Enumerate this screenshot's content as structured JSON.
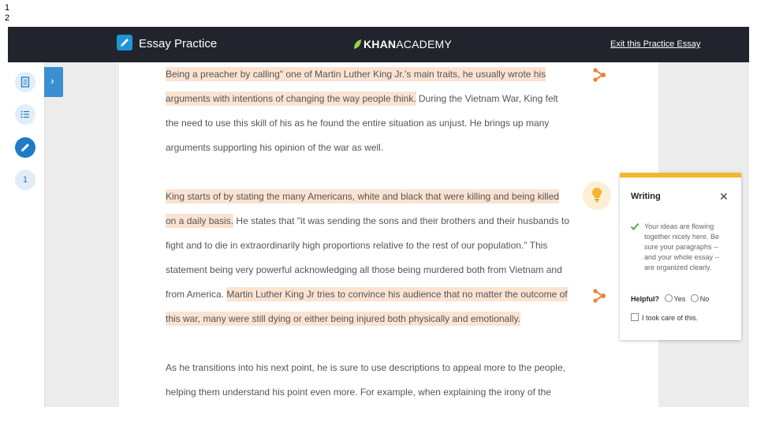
{
  "slide": {
    "numbers": [
      "1",
      "2"
    ]
  },
  "header": {
    "app_title": "Essay Practice",
    "logo_bold": "KHAN",
    "logo_rest": "ACADEMY",
    "exit_label": "Exit this Practice Essay"
  },
  "sidebar": {
    "items": [
      {
        "icon": "document-icon"
      },
      {
        "icon": "list-icon"
      },
      {
        "icon": "pencil-icon",
        "active": true
      },
      {
        "label": "1"
      }
    ],
    "toggle_label": "›"
  },
  "essay": {
    "para1": [
      {
        "parts": [
          {
            "text": "Being a preacher by calling\" one of Martin Luther King Jr.'s main traits, he usually wrote his",
            "hl": true
          }
        ]
      },
      {
        "parts": [
          {
            "text": "arguments with intentions of changing the way people think.",
            "hl": true
          },
          {
            "text": " During the Vietnam War, King felt",
            "hl": false
          }
        ]
      },
      {
        "parts": [
          {
            "text": "the need to use this skill of his as he found the entire situation as unjust. He brings up many",
            "hl": false
          }
        ]
      },
      {
        "parts": [
          {
            "text": "arguments supporting his opinion of the war as well.",
            "hl": false
          }
        ]
      }
    ],
    "para2": [
      {
        "parts": [
          {
            "text": "King starts of by stating the many Americans, white and black that were killing and being killed",
            "hl": true
          }
        ]
      },
      {
        "parts": [
          {
            "text": "on a daily basis.",
            "hl": true
          },
          {
            "text": " He states that \"it was sending the sons and their brothers and their husbands to",
            "hl": false
          }
        ]
      },
      {
        "parts": [
          {
            "text": "fight and to die in extraordinarily high proportions relative to the rest of our population.\" This",
            "hl": false
          }
        ]
      },
      {
        "parts": [
          {
            "text": "statement being very powerful acknowledging all those being murdered both from Vietnam and",
            "hl": false
          }
        ]
      },
      {
        "parts": [
          {
            "text": "from America. ",
            "hl": false
          },
          {
            "text": "Martin Luther King Jr tries to convince his audience that no matter the outcome of",
            "hl": true
          }
        ]
      },
      {
        "parts": [
          {
            "text": "this war, many were still dying or either being injured both physically and emotionally.",
            "hl": true
          }
        ]
      }
    ],
    "para3": [
      {
        "parts": [
          {
            "text": "As he transitions into his next point, he is sure to use descriptions to appeal more to the people,",
            "hl": false
          }
        ]
      },
      {
        "parts": [
          {
            "text": "helping them understand his point even more. For example, when explaining the irony of the",
            "hl": false
          }
        ]
      }
    ]
  },
  "feedback": {
    "category": "Writing",
    "close_icon": "close-icon",
    "message": "Your ideas are flowing together nicely here. Be sure your paragraphs -- and your whole essay -- are organized clearly.",
    "helpful_label": "Helpful?",
    "yes_label": "Yes",
    "no_label": "No",
    "took_care_label": "I took care of this.",
    "accent_color": "#f5b52e",
    "check_color": "#4caf50"
  },
  "colors": {
    "topbar": "#21242c",
    "highlight": "#fbe3d2",
    "flag": "#e8823a",
    "primary": "#1e7bc4"
  }
}
